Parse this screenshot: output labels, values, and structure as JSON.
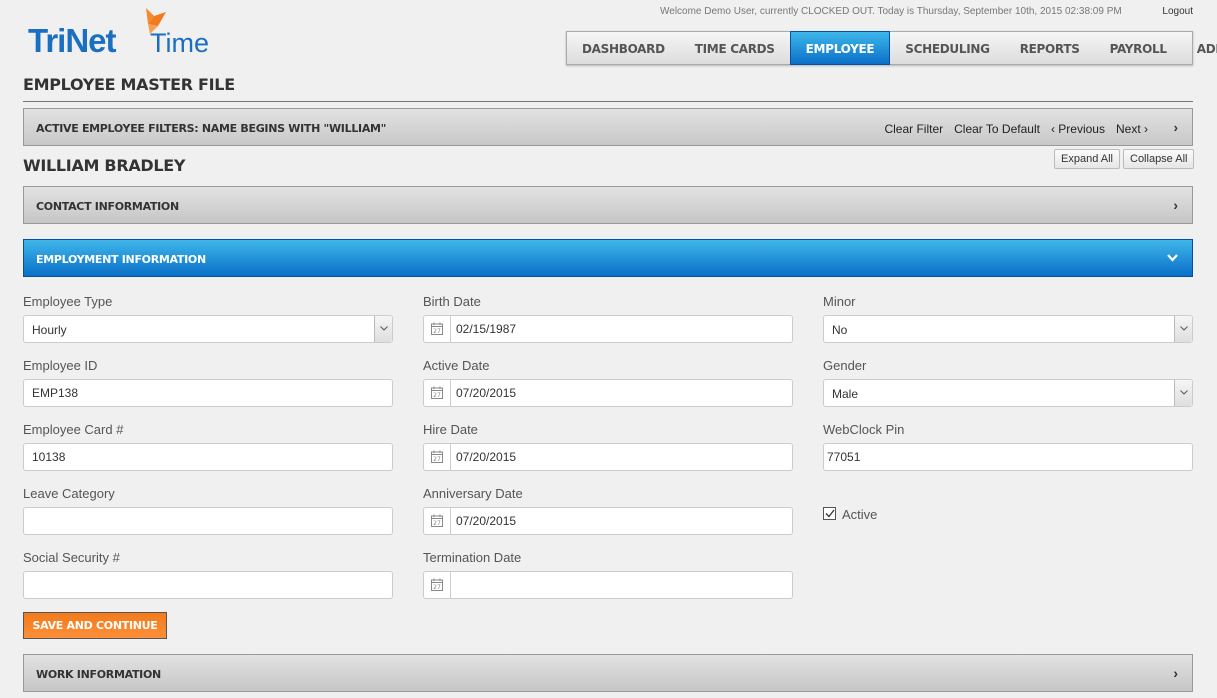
{
  "app": {
    "logo_main": "TriNet",
    "logo_sub": "Time",
    "brand_color": "#1a6fc0",
    "accent_color": "#f27a1a"
  },
  "header": {
    "welcome": "Welcome Demo User, currently CLOCKED OUT. Today is Thursday, September 10th, 2015 02:38:09 PM",
    "logout": "Logout"
  },
  "nav": {
    "items": [
      {
        "label": "DASHBOARD"
      },
      {
        "label": "TIME CARDS"
      },
      {
        "label": "EMPLOYEE",
        "active": true
      },
      {
        "label": "SCHEDULING"
      },
      {
        "label": "REPORTS"
      },
      {
        "label": "PAYROLL"
      },
      {
        "label": "ADMIN"
      }
    ]
  },
  "page": {
    "title": "EMPLOYEE MASTER FILE",
    "employee_name": "WILLIAM BRADLEY"
  },
  "filter": {
    "label": "ACTIVE EMPLOYEE FILTERS: NAME BEGINS WITH \"WILLIAM\"",
    "clear_filter": "Clear Filter",
    "clear_default": "Clear To Default",
    "previous": "‹ Previous",
    "next": "Next ›"
  },
  "buttons": {
    "expand_all": "Expand All",
    "collapse_all": "Collapse All",
    "save": "SAVE AND CONTINUE"
  },
  "panels": {
    "contact": "CONTACT INFORMATION",
    "employment": "EMPLOYMENT INFORMATION",
    "work": "WORK INFORMATION"
  },
  "form": {
    "employee_type": {
      "label": "Employee Type",
      "value": "Hourly"
    },
    "employee_id": {
      "label": "Employee ID",
      "value": "EMP138"
    },
    "employee_card": {
      "label": "Employee Card #",
      "value": "10138"
    },
    "leave_category": {
      "label": "Leave Category",
      "value": ""
    },
    "ssn": {
      "label": "Social Security #",
      "value": ""
    },
    "birth_date": {
      "label": "Birth Date",
      "value": "02/15/1987"
    },
    "active_date": {
      "label": "Active Date",
      "value": "07/20/2015"
    },
    "hire_date": {
      "label": "Hire Date",
      "value": "07/20/2015"
    },
    "anniversary_date": {
      "label": "Anniversary Date",
      "value": "07/20/2015"
    },
    "termination_date": {
      "label": "Termination Date",
      "value": ""
    },
    "minor": {
      "label": "Minor",
      "value": "No"
    },
    "gender": {
      "label": "Gender",
      "value": "Male"
    },
    "webclock_pin": {
      "label": "WebClock Pin",
      "value": "77051"
    },
    "active": {
      "label": "Active",
      "checked": true
    }
  }
}
